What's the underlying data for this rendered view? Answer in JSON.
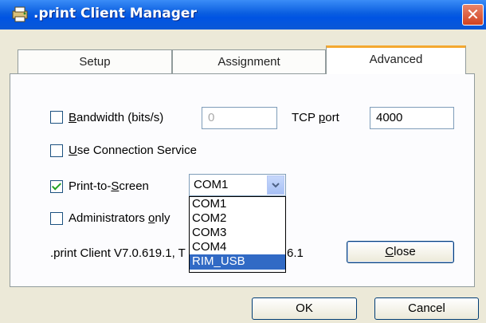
{
  "window": {
    "title": ".print Client Manager",
    "close_glyph": "✕"
  },
  "tabs": [
    {
      "label": "Setup",
      "active": false
    },
    {
      "label": "Assignment",
      "active": false
    },
    {
      "label": "Advanced",
      "active": true
    }
  ],
  "advanced": {
    "bandwidth": {
      "accel_char": "B",
      "label_rest": "andwidth (bits/s)",
      "checked": false,
      "value": "0",
      "enabled": false
    },
    "tcp_port": {
      "label_pre": "TCP ",
      "accel_char": "p",
      "label_post": "ort",
      "value": "4000"
    },
    "use_connection_service": {
      "accel_char": "U",
      "label_rest": "se Connection Service",
      "checked": false
    },
    "print_to_screen": {
      "label_pre": "Print-to-",
      "accel_char": "S",
      "label_post": "creen",
      "checked": true,
      "selected": "COM1",
      "options": [
        "COM1",
        "COM2",
        "COM3",
        "COM4",
        "RIM_USB"
      ],
      "highlighted_option": "RIM_USB"
    },
    "administrators_only": {
      "label_pre": "Administrators ",
      "accel_char": "o",
      "label_post": "nly",
      "checked": false
    },
    "version_left": ".print Client V7.0.619.1, T",
    "version_right": "6.1",
    "close_button": {
      "accel_char": "C",
      "label_rest": "lose"
    }
  },
  "footer": {
    "ok_label": "OK",
    "cancel_label": "Cancel"
  },
  "colors": {
    "title_bar": "#0054e3",
    "tab_highlight": "#f4a830",
    "selection": "#316ac5",
    "close_button": "#d1421f"
  }
}
